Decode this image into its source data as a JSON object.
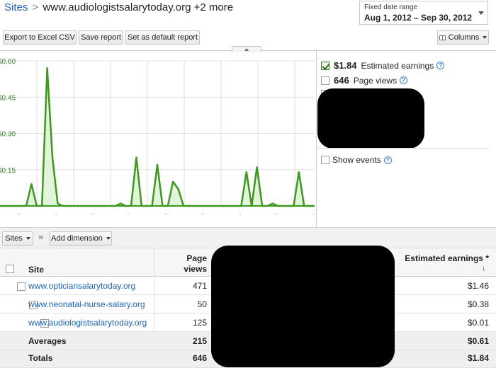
{
  "header": {
    "breadcrumb_root": "Sites",
    "breadcrumb_sep": ">",
    "breadcrumb_current": "www.audiologistsalarytoday.org",
    "breadcrumb_more": "+2 more",
    "date_label": "Fixed date range",
    "date_value": "Aug 1, 2012 – Sep 30, 2012"
  },
  "toolbar": {
    "export_label": "Export to Excel CSV",
    "save_label": "Save report",
    "default_label": "Set as default report",
    "columns_label": "Columns"
  },
  "chart_data": {
    "type": "line",
    "ylim": [
      0,
      0.6
    ],
    "yticks": [
      "$0.60",
      "$0.45",
      "$0.30",
      "$0.15"
    ],
    "series_color": "#3a9a1a",
    "fill_color": "#e4f4dc",
    "x": [
      1,
      2,
      3,
      4,
      5,
      6,
      7,
      8,
      9,
      10,
      11,
      12,
      13,
      14,
      15,
      16,
      17,
      18,
      19,
      20,
      21,
      22,
      23,
      24,
      25,
      26,
      27,
      28,
      29,
      30,
      31,
      32,
      33,
      34,
      35,
      36,
      37,
      38,
      39,
      40,
      41,
      42,
      43,
      44,
      45,
      46,
      47,
      48,
      49,
      50,
      51,
      52,
      53,
      54,
      55,
      56,
      57,
      58,
      59,
      60,
      61
    ],
    "values": [
      0,
      0,
      0,
      0,
      0,
      0,
      0.09,
      0,
      0,
      0.57,
      0.2,
      0.01,
      0,
      0,
      0,
      0,
      0,
      0,
      0,
      0,
      0,
      0,
      0,
      0.01,
      0,
      0,
      0.2,
      0,
      0,
      0,
      0.17,
      0,
      0,
      0.1,
      0.07,
      0,
      0,
      0,
      0,
      0,
      0,
      0,
      0,
      0,
      0,
      0,
      0,
      0.14,
      0,
      0.16,
      0,
      0,
      0.01,
      0,
      0,
      0,
      0,
      0.14,
      0,
      0,
      0
    ],
    "x_tick_marks": [
      "..",
      "..",
      "..",
      "..",
      "..",
      "..",
      "..",
      "..",
      ".."
    ]
  },
  "metrics": {
    "earnings_value": "$1.84",
    "earnings_label": "Estimated earnings",
    "pageviews_value": "646",
    "pageviews_label": "Page views",
    "show_events_label": "Show events",
    "help_glyph": "?"
  },
  "dimensions": {
    "sites_label": "Sites",
    "chevron": "»",
    "add_label": "Add dimension"
  },
  "table": {
    "headers": {
      "site": "Site",
      "pageviews_1": "Page",
      "pageviews_2": "views",
      "earnings": "Estimated earnings *",
      "sort_arrow": "↓"
    },
    "rows": [
      {
        "site": "www.opticiansalarytoday.org",
        "pageviews": "471",
        "earnings": "$1.46"
      },
      {
        "site": "www.neonatal-nurse-salary.org",
        "pageviews": "50",
        "earnings": "$0.38"
      },
      {
        "site": "www.audiologistsalarytoday.org",
        "pageviews": "125",
        "earnings": "$0.01"
      }
    ],
    "averages": {
      "label": "Averages",
      "pageviews": "215",
      "earnings": "$0.61"
    },
    "totals": {
      "label": "Totals",
      "pageviews": "646",
      "earnings": "$1.84"
    }
  }
}
